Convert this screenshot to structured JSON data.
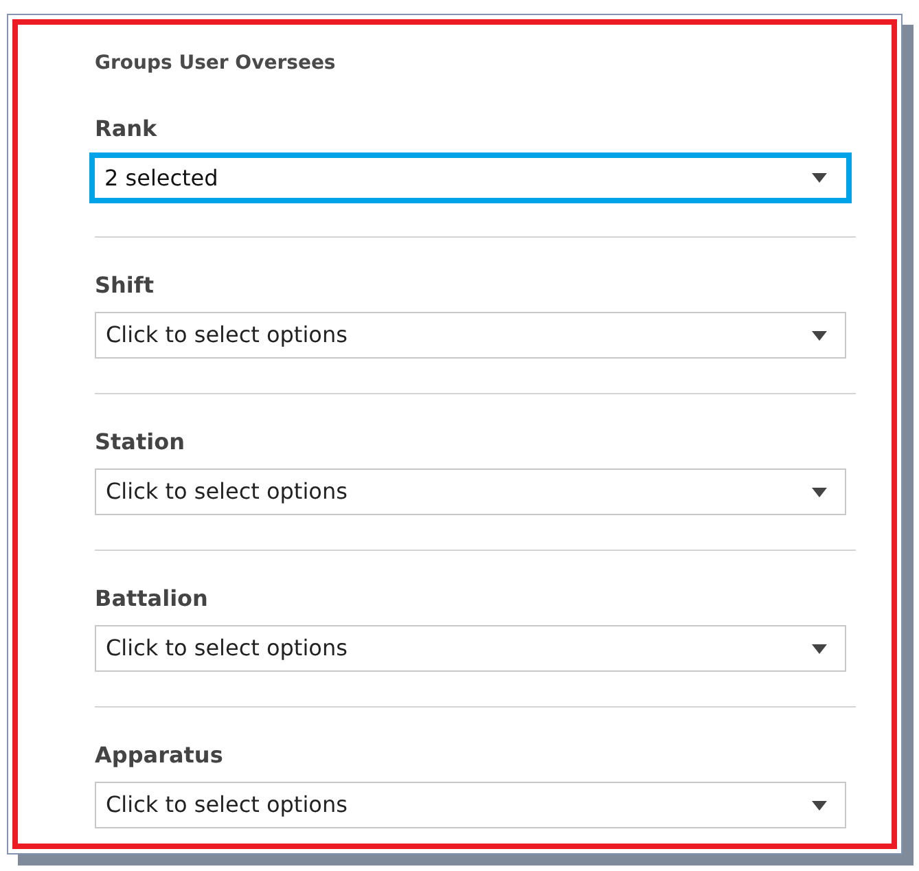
{
  "panel": {
    "title": "Groups User Oversees",
    "fields": [
      {
        "label": "Rank",
        "value": "2 selected",
        "highlighted": true
      },
      {
        "label": "Shift",
        "placeholder": "Click to select options",
        "highlighted": false
      },
      {
        "label": "Station",
        "placeholder": "Click to select options",
        "highlighted": false
      },
      {
        "label": "Battalion",
        "placeholder": "Click to select options",
        "highlighted": false
      },
      {
        "label": "Apparatus",
        "placeholder": "Click to select options",
        "highlighted": false
      }
    ]
  }
}
